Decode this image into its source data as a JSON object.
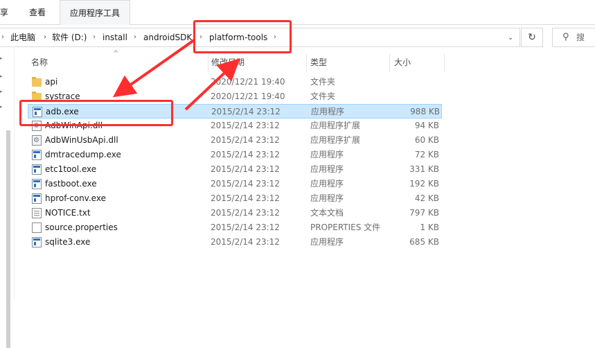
{
  "ribbon": {
    "tabs": [
      {
        "label": "享"
      },
      {
        "label": "查看"
      },
      {
        "label": "应用程序工具"
      }
    ]
  },
  "address": {
    "crumbs": [
      "此电脑",
      "软件 (D:)",
      "install",
      "androidSDK",
      "platform-tools"
    ],
    "search_icon": "search-icon",
    "search_placeholder": "搜"
  },
  "columns": {
    "name": "名称",
    "date": "修改日期",
    "type": "类型",
    "size": "大小"
  },
  "files": [
    {
      "name": "api",
      "date": "2020/12/21 19:40",
      "type": "文件夹",
      "size": "",
      "icon": "folder-icon"
    },
    {
      "name": "systrace",
      "date": "2020/12/21 19:40",
      "type": "文件夹",
      "size": "",
      "icon": "folder-icon"
    },
    {
      "name": "adb.exe",
      "date": "2015/2/14 23:12",
      "type": "应用程序",
      "size": "988 KB",
      "icon": "exe-icon",
      "selected": true
    },
    {
      "name": "AdbWinApi.dll",
      "date": "2015/2/14 23:12",
      "type": "应用程序扩展",
      "size": "94 KB",
      "icon": "dll-icon"
    },
    {
      "name": "AdbWinUsbApi.dll",
      "date": "2015/2/14 23:12",
      "type": "应用程序扩展",
      "size": "60 KB",
      "icon": "dll-icon"
    },
    {
      "name": "dmtracedump.exe",
      "date": "2015/2/14 23:12",
      "type": "应用程序",
      "size": "72 KB",
      "icon": "exe-icon"
    },
    {
      "name": "etc1tool.exe",
      "date": "2015/2/14 23:12",
      "type": "应用程序",
      "size": "331 KB",
      "icon": "exe-icon"
    },
    {
      "name": "fastboot.exe",
      "date": "2015/2/14 23:12",
      "type": "应用程序",
      "size": "192 KB",
      "icon": "exe-icon"
    },
    {
      "name": "hprof-conv.exe",
      "date": "2015/2/14 23:12",
      "type": "应用程序",
      "size": "42 KB",
      "icon": "exe-icon"
    },
    {
      "name": "NOTICE.txt",
      "date": "2015/2/14 23:12",
      "type": "文本文档",
      "size": "797 KB",
      "icon": "text-file-icon"
    },
    {
      "name": "source.properties",
      "date": "2015/2/14 23:12",
      "type": "PROPERTIES 文件",
      "size": "1 KB",
      "icon": "file-icon"
    },
    {
      "name": "sqlite3.exe",
      "date": "2015/2/14 23:12",
      "type": "应用程序",
      "size": "685 KB",
      "icon": "exe-icon"
    }
  ],
  "colors": {
    "selection_bg": "#cce8ff",
    "annotation": "#ff2e2e"
  }
}
